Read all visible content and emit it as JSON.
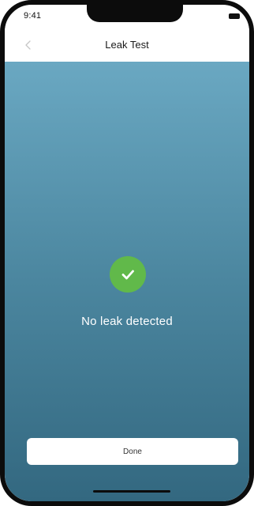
{
  "status_bar": {
    "time": "9:41",
    "battery_icon": "battery-icon"
  },
  "nav": {
    "back_icon": "chevron-left-icon",
    "title": "Leak Test"
  },
  "result": {
    "icon": "checkmark-icon",
    "message": "No leak detected"
  },
  "actions": {
    "done_label": "Done"
  },
  "colors": {
    "success_green": "#61b94a",
    "gradient_top": "#6aa8c2",
    "gradient_bottom": "#336880"
  }
}
